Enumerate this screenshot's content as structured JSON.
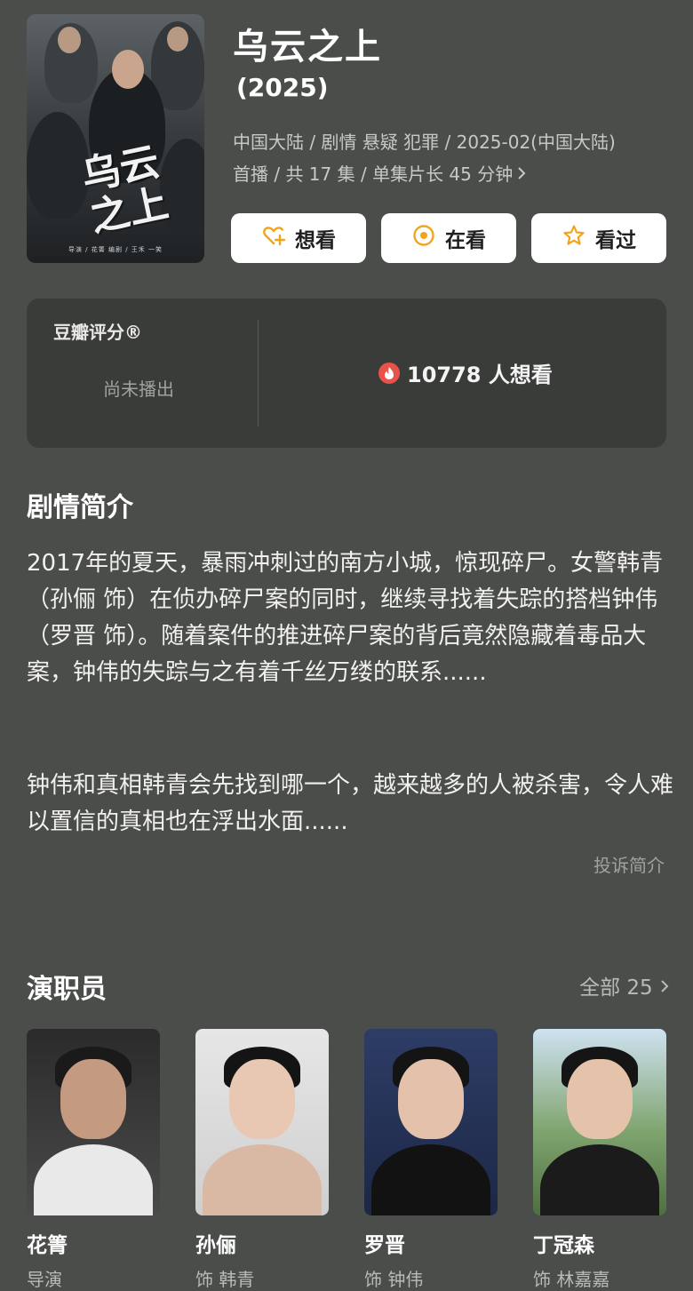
{
  "movie": {
    "title": "乌云之上",
    "year": "(2025)",
    "meta_line1": "中国大陆 / 剧情 悬疑 犯罪 / 2025-02(中国大陆)",
    "meta_line2": "首播 / 共 17 集 / 单集片长 45 分钟",
    "poster_calligraphy": "乌云之上",
    "poster_credits": "导演 / 花箐 编剧 / 王禾 一笑"
  },
  "actions": [
    {
      "label": "想看",
      "icon": "heart-plus-icon"
    },
    {
      "label": "在看",
      "icon": "target-circle-icon"
    },
    {
      "label": "看过",
      "icon": "star-icon"
    }
  ],
  "rating": {
    "label": "豆瓣评分®",
    "status": "尚未播出",
    "want_count": "10778 人想看"
  },
  "synopsis": {
    "title": "剧情简介",
    "paragraph1": "2017年的夏天，暴雨冲刺过的南方小城，惊现碎尸。女警韩青（孙俪 饰）在侦办碎尸案的同时，继续寻找着失踪的搭档钟伟（罗晋 饰）。随着案件的推进碎尸案的背后竟然隐藏着毒品大案，钟伟的失踪与之有着千丝万缕的联系......",
    "paragraph2": "钟伟和真相韩青会先找到哪一个，越来越多的人被杀害，令人难以置信的真相也在浮出水面......",
    "report": "投诉简介"
  },
  "cast": {
    "title": "演职员",
    "all_label": "全部 25",
    "members": [
      {
        "name": "花箐",
        "role": "导演"
      },
      {
        "name": "孙俪",
        "role": "饰 韩青"
      },
      {
        "name": "罗晋",
        "role": "饰 钟伟"
      },
      {
        "name": "丁冠森",
        "role": "饰 林嘉嘉"
      }
    ]
  },
  "colors": {
    "background": "#4a4d49",
    "card": "#3a3c39",
    "accent_orange": "#f2a51a",
    "flame_red": "#e8524a"
  }
}
